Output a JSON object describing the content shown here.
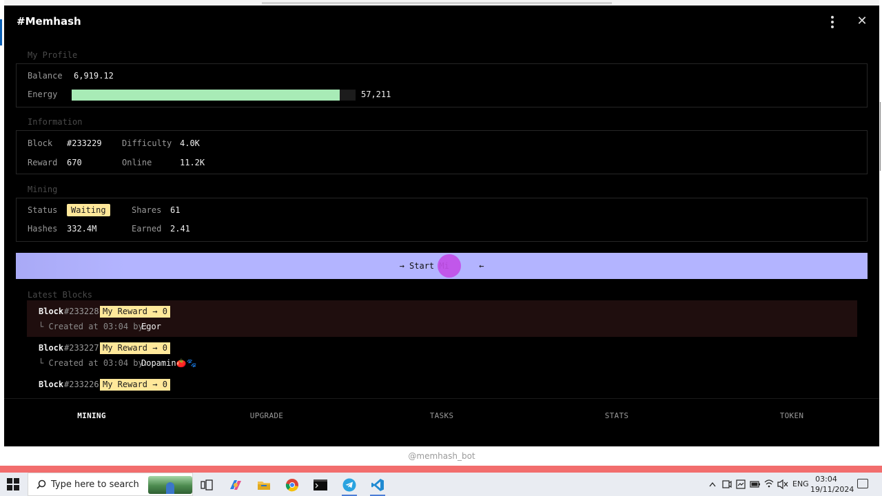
{
  "window": {
    "title": "#Memhash",
    "footer": "@memhash_bot"
  },
  "profile": {
    "section_title": "My Profile",
    "balance_label": "Balance",
    "balance_value": "6,919.12",
    "energy_label": "Energy",
    "energy_value": "57,211",
    "energy_fraction": 0.945
  },
  "information": {
    "section_title": "Information",
    "block_label": "Block",
    "block_value": "#233229",
    "difficulty_label": "Difficulty",
    "difficulty_value": "4.0K",
    "reward_label": "Reward",
    "reward_value": "670",
    "online_label": "Online",
    "online_value": "11.2K"
  },
  "mining": {
    "section_title": "Mining",
    "status_label": "Status",
    "status_value": "Waiting",
    "shares_label": "Shares",
    "shares_value": "61",
    "hashes_label": "Hashes",
    "hashes_value": "332.4M",
    "earned_label": "Earned",
    "earned_value": "2.41",
    "button_label": "→ Start Mi      ←"
  },
  "latest_blocks": {
    "section_title": "Latest Blocks",
    "items": [
      {
        "label": "Block",
        "number": "#233228",
        "reward": "My Reward → 0",
        "created": "└ Created at 03:04 by:",
        "by": "Egor"
      },
      {
        "label": "Block",
        "number": "#233227",
        "reward": "My Reward → 0",
        "created": "└ Created at 03:04 by:",
        "by": "Dopamin🍅🐾"
      },
      {
        "label": "Block",
        "number": "#233226",
        "reward": "My Reward → 0",
        "created": "",
        "by": ""
      }
    ]
  },
  "tabs": [
    "MINING",
    "UPGRADE",
    "TASKS",
    "STATS",
    "TOKEN"
  ],
  "taskbar": {
    "search_placeholder": "Type here to search",
    "lang": "ENG",
    "time": "03:04",
    "date": "19/11/2024"
  },
  "colors": {
    "accent": "#b3b4ff",
    "energy": "#a8ebb6",
    "badge": "#ffe89a",
    "touch": "#c24fe8"
  }
}
